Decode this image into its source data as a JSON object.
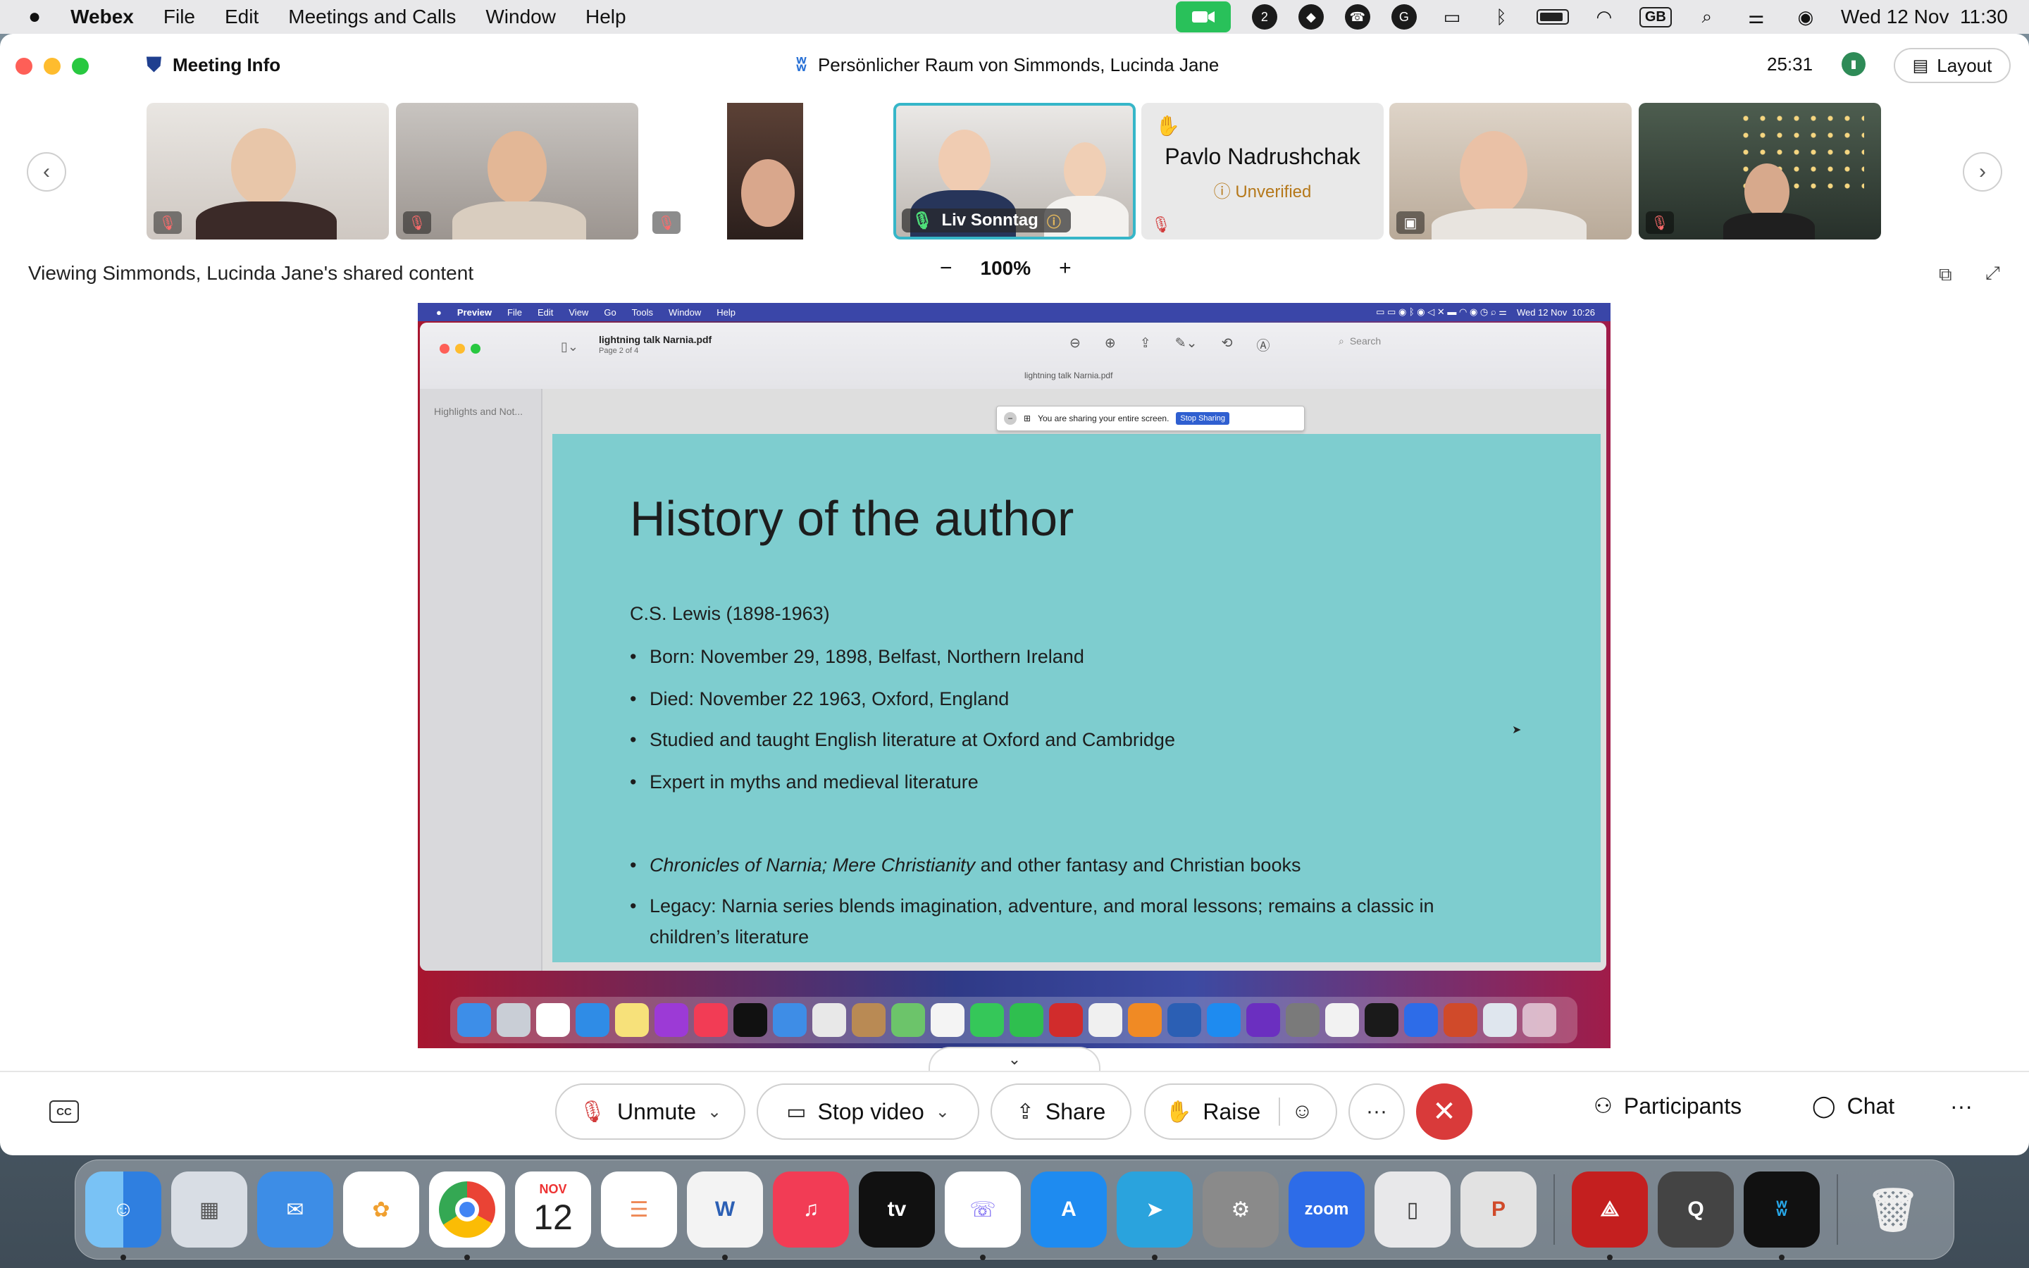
{
  "menubar": {
    "app_name": "Webex",
    "menus": [
      "File",
      "Edit",
      "Meetings and Calls",
      "Window",
      "Help"
    ],
    "input_source": "GB",
    "datetime": "Wed 12 Nov  11:30",
    "icon_badge": "2"
  },
  "window": {
    "meeting_info_label": "Meeting Info",
    "room_title": "Persönlicher Raum von Simmonds, Lucinda Jane",
    "timer": "25:31",
    "layout_label": "Layout"
  },
  "participants": {
    "active_speaker_name": "Liv Sonntag",
    "avatar_tile_name": "Pavlo Nadrushchak",
    "avatar_tile_status": "Unverified"
  },
  "stage": {
    "viewing_text": "Viewing Simmonds, Lucinda Jane's shared content",
    "zoom_level": "100%",
    "zoom_out": "−",
    "zoom_in": "+"
  },
  "shared_screen": {
    "menubar": {
      "app": "Preview",
      "menus": [
        "File",
        "Edit",
        "View",
        "Go",
        "Tools",
        "Window",
        "Help"
      ],
      "datetime": "Wed 12 Nov  10:26"
    },
    "doc_name": "lightning talk Narnia.pdf",
    "page_label": "Page 2 of 4",
    "tab_title": "lightning talk Narnia.pdf",
    "sidebar_label": "Highlights and Not...",
    "search_placeholder": "Search",
    "banner_text": "You are sharing your entire screen.",
    "banner_button": "Stop Sharing",
    "slide": {
      "title": "History of the author",
      "subtitle": "C.S. Lewis (1898-1963)",
      "bullets": [
        "Born: November 29, 1898, Belfast, Northern Ireland",
        "Died: November 22 1963, Oxford, England",
        "Studied and taught English literature at Oxford and Cambridge",
        "Expert in myths and medieval literature"
      ],
      "bullet_books_italic": "Chronicles of Narnia; Mere Christianity",
      "bullet_books_rest": " and other fantasy and Christian books",
      "bullet_legacy": "Legacy: Narnia series blends imagination, adventure, and moral lessons; remains a classic in children’s literature"
    }
  },
  "controls": {
    "cc_label": "CC",
    "unmute": "Unmute",
    "stop_video": "Stop video",
    "share": "Share",
    "raise": "Raise",
    "more": "···",
    "participants": "Participants",
    "chat": "Chat",
    "overflow": "···"
  },
  "dock": {
    "calendar_month": "NOV",
    "calendar_day": "12",
    "zoom_label": "zoom",
    "appletv_label": "tv"
  },
  "colors": {
    "leave_red": "#d93a3a",
    "speaker_border": "#36b6c8",
    "slide_bg": "#7ecdcf",
    "camera_green": "#29c15a"
  }
}
